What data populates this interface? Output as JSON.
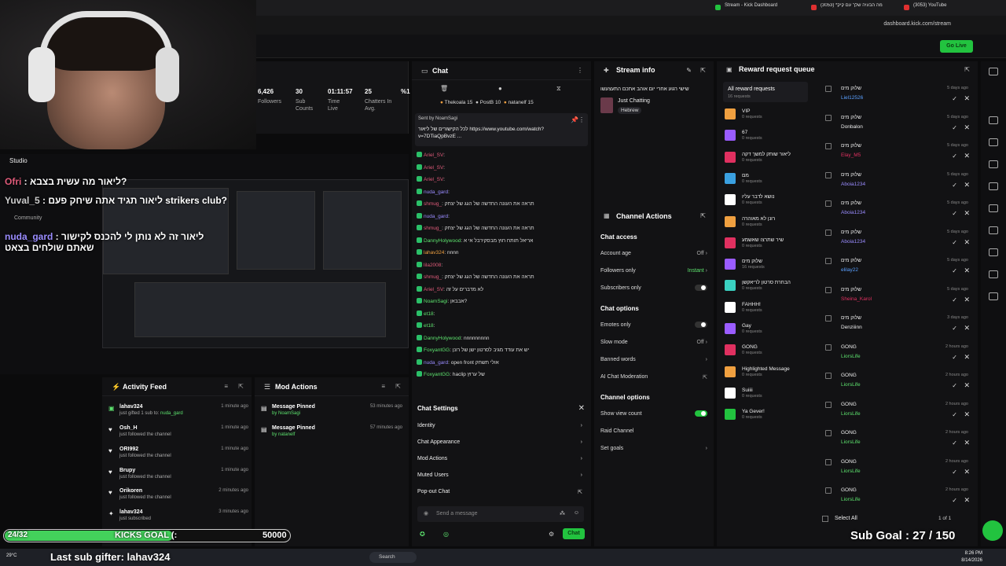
{
  "browser": {
    "tabs": [
      {
        "label": "Stream - Kick Dashboard",
        "color": "#22c33f"
      },
      {
        "label": "(3053) *מה הבעיה שלך עם קיק",
        "color": "#e03030"
      },
      {
        "label": "(3053) YouTube",
        "color": "#e03030"
      }
    ],
    "url": "dashboard.kick.com/stream",
    "go_live": "Go Live"
  },
  "stats": [
    {
      "value": "6,426",
      "label": "Followers"
    },
    {
      "value": "30",
      "label": "Sub Counts"
    },
    {
      "value": "01:11:57",
      "label": "Time Live"
    },
    {
      "value": "25",
      "label": "Chatters In Avg."
    },
    {
      "value": "%1",
      "label": ""
    }
  ],
  "studio": {
    "title": "Studio",
    "community": "Community"
  },
  "overlay_chat": [
    {
      "user": "Ofri",
      "text": "ליאור מה עשית בצבא?"
    },
    {
      "user": "Yuval_5",
      "text": "ליאור תגיד אתה שיחק פעם strikers club?"
    },
    {
      "user": "nuda_gard",
      "text": "ליאור זה לא נותן לי להכנס לקישור שאתם שולחים בצאט"
    }
  ],
  "activity": {
    "title": "Activity Feed",
    "items": [
      {
        "name": "lahav324",
        "sub": "just gifted 1 sub to:",
        "target": "nuda_gard",
        "time": "1 minute ago",
        "icon": "gift-icon"
      },
      {
        "name": "Osh_H",
        "sub": "just followed the channel",
        "target": "",
        "time": "1 minute ago",
        "icon": "heart-icon"
      },
      {
        "name": "ORI992",
        "sub": "just followed the channel",
        "target": "",
        "time": "1 minute ago",
        "icon": "heart-icon"
      },
      {
        "name": "Brupy",
        "sub": "just followed the channel",
        "target": "",
        "time": "1 minute ago",
        "icon": "heart-icon"
      },
      {
        "name": "Orikoren",
        "sub": "just followed the channel",
        "target": "",
        "time": "2 minutes ago",
        "icon": "heart-icon"
      },
      {
        "name": "lahav324",
        "sub": "just subscribed",
        "target": "",
        "time": "3 minutes ago",
        "icon": "star-icon"
      }
    ]
  },
  "mod_actions": {
    "title": "Mod Actions",
    "items": [
      {
        "action": "Message Pinned",
        "by": "by NoamSagi",
        "time": "53 minutes ago"
      },
      {
        "action": "Message Pinned",
        "by": "by natanelf",
        "time": "57 minutes ago"
      }
    ]
  },
  "chat": {
    "title": "Chat",
    "top_users": [
      "Thekoala 15",
      "PostB 10",
      "natanelf 15"
    ],
    "pinned_by": "Sent by NoamSagi",
    "pinned_text": "לכל הקישורים של ליאור https://www.youtube.com/watch?v=7DTiaQpBvzE ...",
    "messages": [
      {
        "user": "Ariel_SV",
        "text": "",
        "cls": "u-red"
      },
      {
        "user": "Ariel_SV",
        "text": "",
        "cls": "u-red"
      },
      {
        "user": "Ariel_SV",
        "text": "",
        "cls": "u-red"
      },
      {
        "user": "nuda_gard",
        "text": "",
        "cls": "u-pur"
      },
      {
        "user": "shmug_",
        "text": "תראה את העונה החדשה של הגג של יצחק",
        "cls": "u-red"
      },
      {
        "user": "nuda_gard",
        "text": "",
        "cls": "u-pur"
      },
      {
        "user": "shmug_",
        "text": "תראה את העונה החדשה של הגג של יצחק",
        "cls": "u-red"
      },
      {
        "user": "DannyHolywood",
        "text": "אריאל תותח חוץ מבסקירבל אי א",
        "cls": "u-green"
      },
      {
        "user": "lahav324",
        "text": "nnnn",
        "cls": "u-orng"
      },
      {
        "user": "lila2008",
        "text": "",
        "cls": "u-red"
      },
      {
        "user": "shmug_",
        "text": "תראה את העונה החדשה של הגג של יצחק",
        "cls": "u-red"
      },
      {
        "user": "Ariel_SV",
        "text": "לא מדברים על זה",
        "cls": "u-red"
      },
      {
        "user": "NoamSagi",
        "text": "אבבאן?",
        "cls": "u-green"
      },
      {
        "user": "et18",
        "text": "",
        "cls": "u-green"
      },
      {
        "user": "et18",
        "text": "",
        "cls": "u-green"
      },
      {
        "user": "DannyHolywood",
        "text": "nnnnnnnnn",
        "cls": "u-green"
      },
      {
        "user": "FoxyantGG",
        "text": "יש את עודד מגיב לסרטון ישן של רונן",
        "cls": "u-green"
      },
      {
        "user": "nuda_gard",
        "text": "open front אולי תשחק",
        "cls": "u-pur"
      },
      {
        "user": "FoxyantGG",
        "text": "haclip של ערוץ",
        "cls": "u-green"
      }
    ],
    "settings_title": "Chat Settings",
    "settings": [
      "Identity",
      "Chat Appearance",
      "Mod Actions",
      "Muted Users",
      "Pop-out Chat"
    ],
    "placeholder": "Send a message",
    "send": "Chat"
  },
  "stream_info": {
    "title": "Stream info",
    "stream_title": "שישי רגוע אחרי יום אוהב אתכם התעצעשו",
    "category": "Just Chatting",
    "tag": "Hebrew"
  },
  "channel_actions": {
    "title": "Channel Actions",
    "chat_access": "Chat access",
    "account_age": "Account age",
    "account_age_val": "Off",
    "followers_only": "Followers only",
    "followers_only_val": "Instant",
    "subscribers_only": "Subscribers only",
    "chat_options": "Chat options",
    "emotes_only": "Emotes only",
    "slow_mode": "Slow mode",
    "slow_mode_val": "Off",
    "banned_words": "Banned words",
    "ai_mod": "AI Chat Moderation",
    "channel_options": "Channel options",
    "show_view_count": "Show view count",
    "raid": "Raid Channel",
    "set_goals": "Set goals"
  },
  "reward": {
    "title": "Reward request queue",
    "all": "All reward requests",
    "all_count": "16 requests",
    "rewards": [
      {
        "name": "VIP",
        "count": "0 requests",
        "color": "#f0a040"
      },
      {
        "name": "67",
        "count": "0 requests",
        "color": "#9a5cff"
      },
      {
        "name": "ליאור שותק למשך דקה",
        "count": "0 requests",
        "color": "#e03060"
      },
      {
        "name": "מם",
        "count": "0 requests",
        "color": "#3aa0e0"
      },
      {
        "name": "נושא לדבר עליו",
        "count": "0 requests",
        "color": "#ffffff"
      },
      {
        "name": "רונן לא מאוהרה",
        "count": "0 requests",
        "color": "#f0a040"
      },
      {
        "name": "שיר שתרצו שאשמע",
        "count": "0 requests",
        "color": "#e03060"
      },
      {
        "name": "שלוק מים",
        "count": "16 requests",
        "color": "#9a5cff"
      },
      {
        "name": "הבחרת סרטון לריאקשן",
        "count": "0 requests",
        "color": "#3ad0c0"
      },
      {
        "name": "FAHHH!",
        "count": "0 requests",
        "color": "#ffffff"
      },
      {
        "name": "Gay",
        "count": "0 requests",
        "color": "#9a5cff"
      },
      {
        "name": "GONG",
        "count": "0 requests",
        "color": "#e03060"
      },
      {
        "name": "Highlighted Message",
        "count": "0 requests",
        "color": "#f0a040"
      },
      {
        "name": "Suiiii",
        "count": "0 requests",
        "color": "#ffffff"
      },
      {
        "name": "Ya Gever!",
        "count": "0 requests",
        "color": "#22c33f"
      }
    ],
    "queue": [
      {
        "title": "שלוק מים",
        "user": "Liel12526",
        "color": "#5aa0ff",
        "time": "5 days ago"
      },
      {
        "title": "שלוק מים",
        "user": "Donbalon",
        "color": "#eeeeee",
        "time": "5 days ago"
      },
      {
        "title": "שלוק מים",
        "user": "Elay_M5",
        "color": "#e03060",
        "time": "5 days ago"
      },
      {
        "title": "שלוק מים",
        "user": "Aboia1234",
        "color": "#9a8cff",
        "time": "5 days ago"
      },
      {
        "title": "שלוק מים",
        "user": "Aboia1234",
        "color": "#9a8cff",
        "time": "5 days ago"
      },
      {
        "title": "שלוק מים",
        "user": "Aboia1234",
        "color": "#9a8cff",
        "time": "5 days ago"
      },
      {
        "title": "שלוק מים",
        "user": "elilay22",
        "color": "#5aa0ff",
        "time": "5 days ago"
      },
      {
        "title": "שלוק מים",
        "user": "Sheina_Karol",
        "color": "#e03060",
        "time": "5 days ago"
      },
      {
        "title": "שלוק מים",
        "user": "Denziiinn",
        "color": "#eeeeee",
        "time": "3 days ago"
      },
      {
        "title": "GONG",
        "user": "LiorsLife",
        "color": "#5de26e",
        "time": "2 hours ago"
      },
      {
        "title": "GONG",
        "user": "LiorsLife",
        "color": "#5de26e",
        "time": "2 hours ago"
      },
      {
        "title": "GONG",
        "user": "LiorsLife",
        "color": "#5de26e",
        "time": "2 hours ago"
      },
      {
        "title": "GONG",
        "user": "LiorsLife",
        "color": "#5de26e",
        "time": "2 hours ago"
      },
      {
        "title": "GONG",
        "user": "LiorsLife",
        "color": "#5de26e",
        "time": "2 hours ago"
      },
      {
        "title": "GONG",
        "user": "LiorsLife",
        "color": "#5de26e",
        "time": "2 hours ago"
      }
    ],
    "select_all": "Select All",
    "page": "1 of 1"
  },
  "overlays": {
    "kicks_left": "24/32",
    "kicks_goal": "KICKS GOAL (:",
    "kicks_target": "50000",
    "kicks_progress": 0.59,
    "last_sub": "Last sub gifter: lahav324",
    "sub_goal": "Sub Goal : 27 / 150"
  },
  "taskbar": {
    "weather": "29°C",
    "time": "8:26 PM",
    "date": "8/14/2026",
    "search": "Search"
  }
}
